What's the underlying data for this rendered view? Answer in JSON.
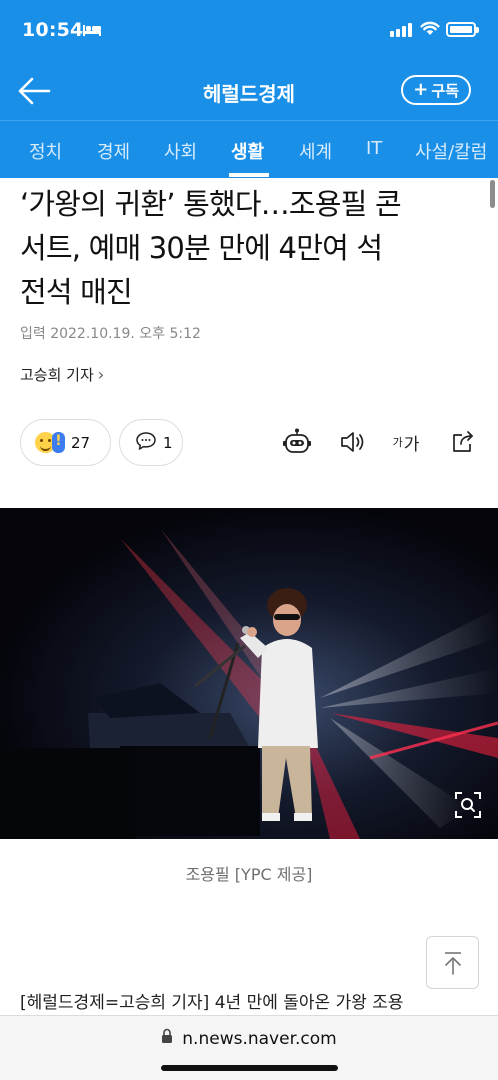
{
  "status": {
    "time": "10:54"
  },
  "header": {
    "title": "헤럴드경제",
    "subscribe_label": "구독"
  },
  "tabs": [
    {
      "label": "정치",
      "active": false
    },
    {
      "label": "경제",
      "active": false
    },
    {
      "label": "사회",
      "active": false
    },
    {
      "label": "생활",
      "active": true
    },
    {
      "label": "세계",
      "active": false
    },
    {
      "label": "IT",
      "active": false
    },
    {
      "label": "사설/칼럼",
      "active": false
    }
  ],
  "article": {
    "headline_lines": [
      "‘가왕의 귀환’ 통했다…조용필 콘",
      "서트, 예매 30분 만에 4만여 석",
      "전석 매진"
    ],
    "date": "입력 2022.10.19. 오후 5:12",
    "reporter": "고승희 기자",
    "reaction_count": "27",
    "comment_count": "1",
    "font_label_small": "가",
    "font_label_large": "가",
    "photo_caption": "조용필 [YPC 제공]",
    "body_preview": "[헤럴드경제=고승희 기자] 4년 만에 돌아온 가왕 조용"
  },
  "browser": {
    "url": "n.news.naver.com"
  },
  "colors": {
    "brand": "#1a8fe8",
    "caption": "#6f6f6f"
  }
}
